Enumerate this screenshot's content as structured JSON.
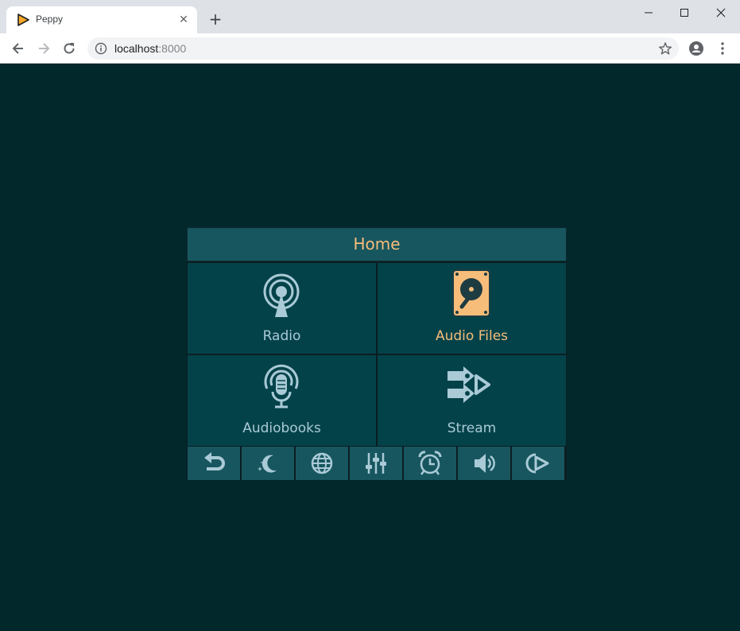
{
  "browser": {
    "tab_title": "Peppy",
    "tab_close": "✕",
    "new_tab": "+",
    "url_host": "localhost",
    "url_port": ":8000"
  },
  "app": {
    "header_title": "Home",
    "tiles": [
      {
        "label": "Radio",
        "icon": "radio-tower-icon"
      },
      {
        "label": "Audio Files",
        "icon": "hard-drive-icon",
        "selected": true
      },
      {
        "label": "Audiobooks",
        "icon": "podcast-microphone-icon"
      },
      {
        "label": "Stream",
        "icon": "stream-arrows-icon"
      }
    ],
    "bottom_bar": [
      "back-icon",
      "screensaver-icon",
      "language-icon",
      "equalizer-icon",
      "timer-icon",
      "volume-icon",
      "player-icon"
    ]
  },
  "colors": {
    "background": "#02282b",
    "tile": "#04424a",
    "header": "#17565f",
    "text": "#a9cad6",
    "accent": "#f6bd7a"
  }
}
